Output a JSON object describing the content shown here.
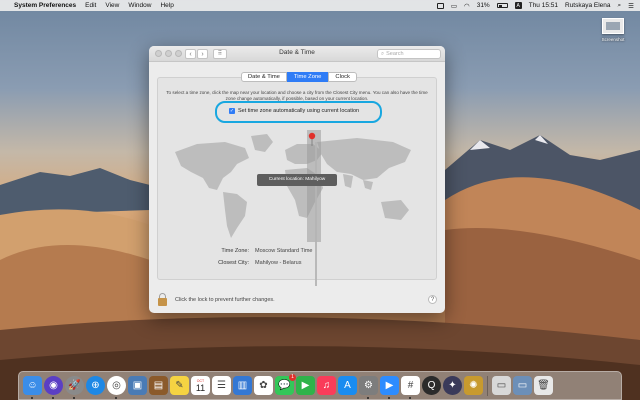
{
  "menubar": {
    "app_name": "System Preferences",
    "items": [
      "Edit",
      "View",
      "Window",
      "Help"
    ],
    "battery": "31%",
    "input_source": "A",
    "clock": "Thu 15:51",
    "user": "Rutskaya Elena"
  },
  "desktop": {
    "icon_label": "Screenshot"
  },
  "window": {
    "title": "Date & Time",
    "search_placeholder": "Search",
    "tabs": [
      {
        "label": "Date & Time",
        "active": false
      },
      {
        "label": "Time Zone",
        "active": true
      },
      {
        "label": "Clock",
        "active": false
      }
    ],
    "instructions": "To select a time zone, click the map near your location and choose a city from the Closest City menu. You can also have the time zone change automatically, if possible, based on your current location.",
    "auto_checkbox": {
      "label": "Set time zone automatically using current location",
      "checked": true
    },
    "current_location": "Current location: Mahilyow",
    "time_zone": {
      "label": "Time Zone:",
      "value": "Moscow Standard Time"
    },
    "closest_city": {
      "label": "Closest City:",
      "value": "Mahilyow - Belarus"
    },
    "lock_text": "Click the lock to prevent further changes.",
    "help": "?"
  },
  "dock": {
    "calendar_month": "OCT",
    "calendar_day": "11",
    "apps": [
      {
        "name": "finder-icon",
        "color": "#3b8de8",
        "glyph": "☺"
      },
      {
        "name": "siri-icon",
        "color": "#5b3fc4",
        "glyph": "◉"
      },
      {
        "name": "launchpad-icon",
        "color": "#8a8a8a",
        "glyph": "🚀"
      },
      {
        "name": "safari-icon",
        "color": "#1e88e5",
        "glyph": "⊕"
      },
      {
        "name": "chrome-icon",
        "color": "#ffffff",
        "glyph": "◎"
      },
      {
        "name": "preview-icon",
        "color": "#4a7bb5",
        "glyph": "▣"
      },
      {
        "name": "notes-book-icon",
        "color": "#8b5a2b",
        "glyph": "▤"
      },
      {
        "name": "notes-icon",
        "color": "#f5d342",
        "glyph": "✎"
      },
      {
        "name": "reminders-icon",
        "color": "#ffffff",
        "glyph": "☰"
      },
      {
        "name": "keynote-icon",
        "color": "#3478d4",
        "glyph": "▥"
      },
      {
        "name": "photos-icon",
        "color": "#ffffff",
        "glyph": "✿"
      },
      {
        "name": "messages-icon",
        "color": "#34c759",
        "glyph": "💬"
      },
      {
        "name": "facetime-icon",
        "color": "#2fb34a",
        "glyph": "▶"
      },
      {
        "name": "music-icon",
        "color": "#fa3c5a",
        "glyph": "♫"
      },
      {
        "name": "app-store-icon",
        "color": "#1a8cf0",
        "glyph": "A"
      },
      {
        "name": "system-preferences-icon",
        "color": "#7d7d7d",
        "glyph": "⚙"
      },
      {
        "name": "zoom-icon",
        "color": "#2d8cff",
        "glyph": "▶"
      },
      {
        "name": "slack-icon",
        "color": "#ffffff",
        "glyph": "#"
      },
      {
        "name": "quicktime-icon",
        "color": "#2b2b2b",
        "glyph": "Q"
      },
      {
        "name": "compass-icon",
        "color": "#3a3a5a",
        "glyph": "✦"
      },
      {
        "name": "gold-app-icon",
        "color": "#c89a2e",
        "glyph": "✺"
      },
      {
        "name": "documents-folder-icon",
        "color": "#d8d8d8",
        "glyph": "▭"
      },
      {
        "name": "downloads-folder-icon",
        "color": "#6c8fb8",
        "glyph": "▭"
      },
      {
        "name": "trash-icon",
        "color": "#e8e8e8",
        "glyph": "🗑"
      }
    ],
    "mail_badge": "1"
  }
}
